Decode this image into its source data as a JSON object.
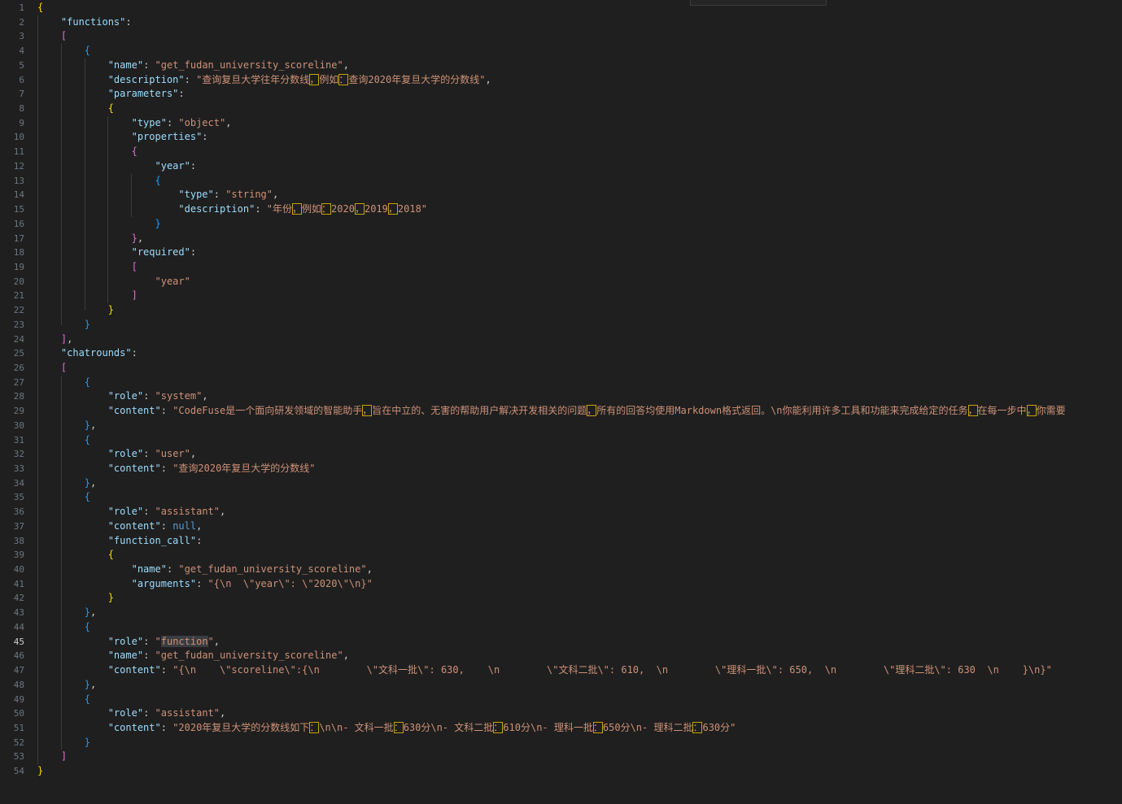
{
  "active_line": 45,
  "lines": [
    [
      {
        "t": "{",
        "c": "b1"
      }
    ],
    [
      {
        "t": "    "
      },
      {
        "t": "\"functions\"",
        "c": "k"
      },
      {
        "t": ":",
        "c": "c"
      }
    ],
    [
      {
        "t": "    "
      },
      {
        "t": "[",
        "c": "b2"
      }
    ],
    [
      {
        "t": "        "
      },
      {
        "t": "{",
        "c": "b3"
      }
    ],
    [
      {
        "t": "            "
      },
      {
        "t": "\"name\"",
        "c": "k"
      },
      {
        "t": ": ",
        "c": "c"
      },
      {
        "t": "\"get_fudan_university_scoreline\"",
        "c": "s"
      },
      {
        "t": ",",
        "c": "c"
      }
    ],
    [
      {
        "t": "            "
      },
      {
        "t": "\"description\"",
        "c": "k"
      },
      {
        "t": ": ",
        "c": "c"
      },
      {
        "t": "\"查询复旦大学往年分数线",
        "c": "s"
      },
      {
        "t": "，",
        "c": "s",
        "u": 1
      },
      {
        "t": "例如",
        "c": "s"
      },
      {
        "t": "：",
        "c": "s",
        "u": 1
      },
      {
        "t": "查询2020年复旦大学的分数线\"",
        "c": "s"
      },
      {
        "t": ",",
        "c": "c"
      }
    ],
    [
      {
        "t": "            "
      },
      {
        "t": "\"parameters\"",
        "c": "k"
      },
      {
        "t": ":",
        "c": "c"
      }
    ],
    [
      {
        "t": "            "
      },
      {
        "t": "{",
        "c": "b1"
      }
    ],
    [
      {
        "t": "                "
      },
      {
        "t": "\"type\"",
        "c": "k"
      },
      {
        "t": ": ",
        "c": "c"
      },
      {
        "t": "\"object\"",
        "c": "s"
      },
      {
        "t": ",",
        "c": "c"
      }
    ],
    [
      {
        "t": "                "
      },
      {
        "t": "\"properties\"",
        "c": "k"
      },
      {
        "t": ":",
        "c": "c"
      }
    ],
    [
      {
        "t": "                "
      },
      {
        "t": "{",
        "c": "b2"
      }
    ],
    [
      {
        "t": "                    "
      },
      {
        "t": "\"year\"",
        "c": "k"
      },
      {
        "t": ":",
        "c": "c"
      }
    ],
    [
      {
        "t": "                    "
      },
      {
        "t": "{",
        "c": "b3"
      }
    ],
    [
      {
        "t": "                        "
      },
      {
        "t": "\"type\"",
        "c": "k"
      },
      {
        "t": ": ",
        "c": "c"
      },
      {
        "t": "\"string\"",
        "c": "s"
      },
      {
        "t": ",",
        "c": "c"
      }
    ],
    [
      {
        "t": "                        "
      },
      {
        "t": "\"description\"",
        "c": "k"
      },
      {
        "t": ": ",
        "c": "c"
      },
      {
        "t": "\"年份",
        "c": "s"
      },
      {
        "t": "，",
        "c": "s",
        "u": 1
      },
      {
        "t": "例如",
        "c": "s"
      },
      {
        "t": "：",
        "c": "s",
        "u": 1
      },
      {
        "t": "2020",
        "c": "s"
      },
      {
        "t": "，",
        "c": "s",
        "u": 1
      },
      {
        "t": "2019",
        "c": "s"
      },
      {
        "t": "，",
        "c": "s",
        "u": 1
      },
      {
        "t": "2018\"",
        "c": "s"
      }
    ],
    [
      {
        "t": "                    "
      },
      {
        "t": "}",
        "c": "b3"
      }
    ],
    [
      {
        "t": "                "
      },
      {
        "t": "}",
        "c": "b2"
      },
      {
        "t": ",",
        "c": "c"
      }
    ],
    [
      {
        "t": "                "
      },
      {
        "t": "\"required\"",
        "c": "k"
      },
      {
        "t": ":",
        "c": "c"
      }
    ],
    [
      {
        "t": "                "
      },
      {
        "t": "[",
        "c": "b2"
      }
    ],
    [
      {
        "t": "                    "
      },
      {
        "t": "\"year\"",
        "c": "s"
      }
    ],
    [
      {
        "t": "                "
      },
      {
        "t": "]",
        "c": "b2"
      }
    ],
    [
      {
        "t": "            "
      },
      {
        "t": "}",
        "c": "b1"
      }
    ],
    [
      {
        "t": "        "
      },
      {
        "t": "}",
        "c": "b3"
      }
    ],
    [
      {
        "t": "    "
      },
      {
        "t": "]",
        "c": "b2"
      },
      {
        "t": ",",
        "c": "c"
      }
    ],
    [
      {
        "t": "    "
      },
      {
        "t": "\"chatrounds\"",
        "c": "k"
      },
      {
        "t": ":",
        "c": "c"
      }
    ],
    [
      {
        "t": "    "
      },
      {
        "t": "[",
        "c": "b2"
      }
    ],
    [
      {
        "t": "        "
      },
      {
        "t": "{",
        "c": "b3"
      }
    ],
    [
      {
        "t": "            "
      },
      {
        "t": "\"role\"",
        "c": "k"
      },
      {
        "t": ": ",
        "c": "c"
      },
      {
        "t": "\"system\"",
        "c": "s"
      },
      {
        "t": ",",
        "c": "c"
      }
    ],
    [
      {
        "t": "            "
      },
      {
        "t": "\"content\"",
        "c": "k"
      },
      {
        "t": ": ",
        "c": "c"
      },
      {
        "t": "\"CodeFuse是一个面向研发领域的智能助手",
        "c": "s"
      },
      {
        "t": "，",
        "c": "s",
        "u": 1
      },
      {
        "t": "旨在中立的、无害的帮助用户解决开发相关的问题",
        "c": "s"
      },
      {
        "t": "，",
        "c": "s",
        "u": 1
      },
      {
        "t": "所有的回答均使用Markdown格式返回。\\n你能利用许多工具和功能来完成给定的任务",
        "c": "s"
      },
      {
        "t": "，",
        "c": "s",
        "u": 1
      },
      {
        "t": "在每一步中",
        "c": "s"
      },
      {
        "t": "，",
        "c": "s",
        "u": 1
      },
      {
        "t": "你需要",
        "c": "s"
      }
    ],
    [
      {
        "t": "        "
      },
      {
        "t": "}",
        "c": "b3"
      },
      {
        "t": ",",
        "c": "c"
      }
    ],
    [
      {
        "t": "        "
      },
      {
        "t": "{",
        "c": "b3"
      }
    ],
    [
      {
        "t": "            "
      },
      {
        "t": "\"role\"",
        "c": "k"
      },
      {
        "t": ": ",
        "c": "c"
      },
      {
        "t": "\"user\"",
        "c": "s"
      },
      {
        "t": ",",
        "c": "c"
      }
    ],
    [
      {
        "t": "            "
      },
      {
        "t": "\"content\"",
        "c": "k"
      },
      {
        "t": ": ",
        "c": "c"
      },
      {
        "t": "\"查询2020年复旦大学的分数线\"",
        "c": "s"
      }
    ],
    [
      {
        "t": "        "
      },
      {
        "t": "}",
        "c": "b3"
      },
      {
        "t": ",",
        "c": "c"
      }
    ],
    [
      {
        "t": "        "
      },
      {
        "t": "{",
        "c": "b3"
      }
    ],
    [
      {
        "t": "            "
      },
      {
        "t": "\"role\"",
        "c": "k"
      },
      {
        "t": ": ",
        "c": "c"
      },
      {
        "t": "\"assistant\"",
        "c": "s"
      },
      {
        "t": ",",
        "c": "c"
      }
    ],
    [
      {
        "t": "            "
      },
      {
        "t": "\"content\"",
        "c": "k"
      },
      {
        "t": ": ",
        "c": "c"
      },
      {
        "t": "null",
        "c": "kw"
      },
      {
        "t": ",",
        "c": "c"
      }
    ],
    [
      {
        "t": "            "
      },
      {
        "t": "\"function_call\"",
        "c": "k"
      },
      {
        "t": ":",
        "c": "c"
      }
    ],
    [
      {
        "t": "            "
      },
      {
        "t": "{",
        "c": "b1"
      }
    ],
    [
      {
        "t": "                "
      },
      {
        "t": "\"name\"",
        "c": "k"
      },
      {
        "t": ": ",
        "c": "c"
      },
      {
        "t": "\"get_fudan_university_scoreline\"",
        "c": "s"
      },
      {
        "t": ",",
        "c": "c"
      }
    ],
    [
      {
        "t": "                "
      },
      {
        "t": "\"arguments\"",
        "c": "k"
      },
      {
        "t": ": ",
        "c": "c"
      },
      {
        "t": "\"{\\n  \\\"year\\\": \\\"2020\\\"\\n}\"",
        "c": "s"
      }
    ],
    [
      {
        "t": "            "
      },
      {
        "t": "}",
        "c": "b1"
      }
    ],
    [
      {
        "t": "        "
      },
      {
        "t": "}",
        "c": "b3"
      },
      {
        "t": ",",
        "c": "c"
      }
    ],
    [
      {
        "t": "        "
      },
      {
        "t": "{",
        "c": "b3"
      }
    ],
    [
      {
        "t": "            "
      },
      {
        "t": "\"role\"",
        "c": "k"
      },
      {
        "t": ": ",
        "c": "c"
      },
      {
        "t": "\"",
        "c": "s"
      },
      {
        "t": "function",
        "c": "s",
        "h": 1
      },
      {
        "t": "\"",
        "c": "s"
      },
      {
        "t": ",",
        "c": "c"
      }
    ],
    [
      {
        "t": "            "
      },
      {
        "t": "\"name\"",
        "c": "k"
      },
      {
        "t": ": ",
        "c": "c"
      },
      {
        "t": "\"get_fudan_university_scoreline\"",
        "c": "s"
      },
      {
        "t": ",",
        "c": "c"
      }
    ],
    [
      {
        "t": "            "
      },
      {
        "t": "\"content\"",
        "c": "k"
      },
      {
        "t": ": ",
        "c": "c"
      },
      {
        "t": "\"{\\n    \\\"scoreline\\\":{\\n        \\\"文科一批\\\": 630,    \\n        \\\"文科二批\\\": 610,  \\n        \\\"理科一批\\\": 650,  \\n        \\\"理科二批\\\": 630  \\n    }\\n}\"",
        "c": "s"
      }
    ],
    [
      {
        "t": "        "
      },
      {
        "t": "}",
        "c": "b3"
      },
      {
        "t": ",",
        "c": "c"
      }
    ],
    [
      {
        "t": "        "
      },
      {
        "t": "{",
        "c": "b3"
      }
    ],
    [
      {
        "t": "            "
      },
      {
        "t": "\"role\"",
        "c": "k"
      },
      {
        "t": ": ",
        "c": "c"
      },
      {
        "t": "\"assistant\"",
        "c": "s"
      },
      {
        "t": ",",
        "c": "c"
      }
    ],
    [
      {
        "t": "            "
      },
      {
        "t": "\"content\"",
        "c": "k"
      },
      {
        "t": ": ",
        "c": "c"
      },
      {
        "t": "\"2020年复旦大学的分数线如下",
        "c": "s"
      },
      {
        "t": "：",
        "c": "s",
        "u": 1
      },
      {
        "t": "\\n\\n- 文科一批",
        "c": "s"
      },
      {
        "t": "：",
        "c": "s",
        "u": 1
      },
      {
        "t": "630分\\n- 文科二批",
        "c": "s"
      },
      {
        "t": "：",
        "c": "s",
        "u": 1
      },
      {
        "t": "610分\\n- 理科一批",
        "c": "s"
      },
      {
        "t": "：",
        "c": "s",
        "u": 1
      },
      {
        "t": "650分\\n- 理科二批",
        "c": "s"
      },
      {
        "t": "：",
        "c": "s",
        "u": 1
      },
      {
        "t": "630分\"",
        "c": "s"
      }
    ],
    [
      {
        "t": "        "
      },
      {
        "t": "}",
        "c": "b3"
      }
    ],
    [
      {
        "t": "    "
      },
      {
        "t": "]",
        "c": "b2"
      }
    ],
    [
      {
        "t": "}",
        "c": "b1"
      }
    ]
  ]
}
